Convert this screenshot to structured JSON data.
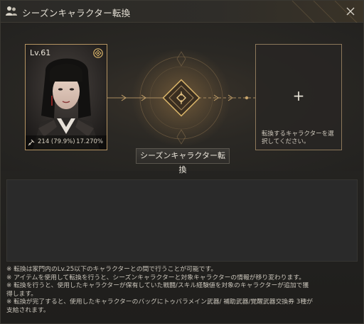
{
  "window": {
    "title": "シーズンキャラクター転換",
    "icon": "users-icon",
    "close_icon": "close-icon"
  },
  "source_character": {
    "level": "Lv.61",
    "class_icon": "class-emblem-icon",
    "skill_icon": "skill-icon",
    "skill_level": "214 (79.9%)",
    "experience": "17.270%"
  },
  "target_slot": {
    "plus": "+",
    "hint": "転換するキャラクターを選択してください。"
  },
  "transfer_button": "シーズンキャラクター転換",
  "notes": [
    "※ 転換は家門内のLv.25以下のキャラクターとの間で行うことが可能です。",
    "※ アイテムを使用して転換を行うと、シーズンキャラクターと対象キャラクターの情報が移り変わります。",
    "  ※ 転換を行うと、使用したキャラクターが保有していた戦闘/スキル経験値を対象のキャラクターが追加で獲",
    "  得します。",
    "※ 転換が完了すると、使用したキャラクターのバッグにトゥバラメイン武器/ 補助武器/覚醒武器交換券 3種が",
    "  支給されます。"
  ],
  "colors": {
    "accent_gold": "#b59462",
    "background": "#1b1a19",
    "text": "#d8d3c8"
  }
}
